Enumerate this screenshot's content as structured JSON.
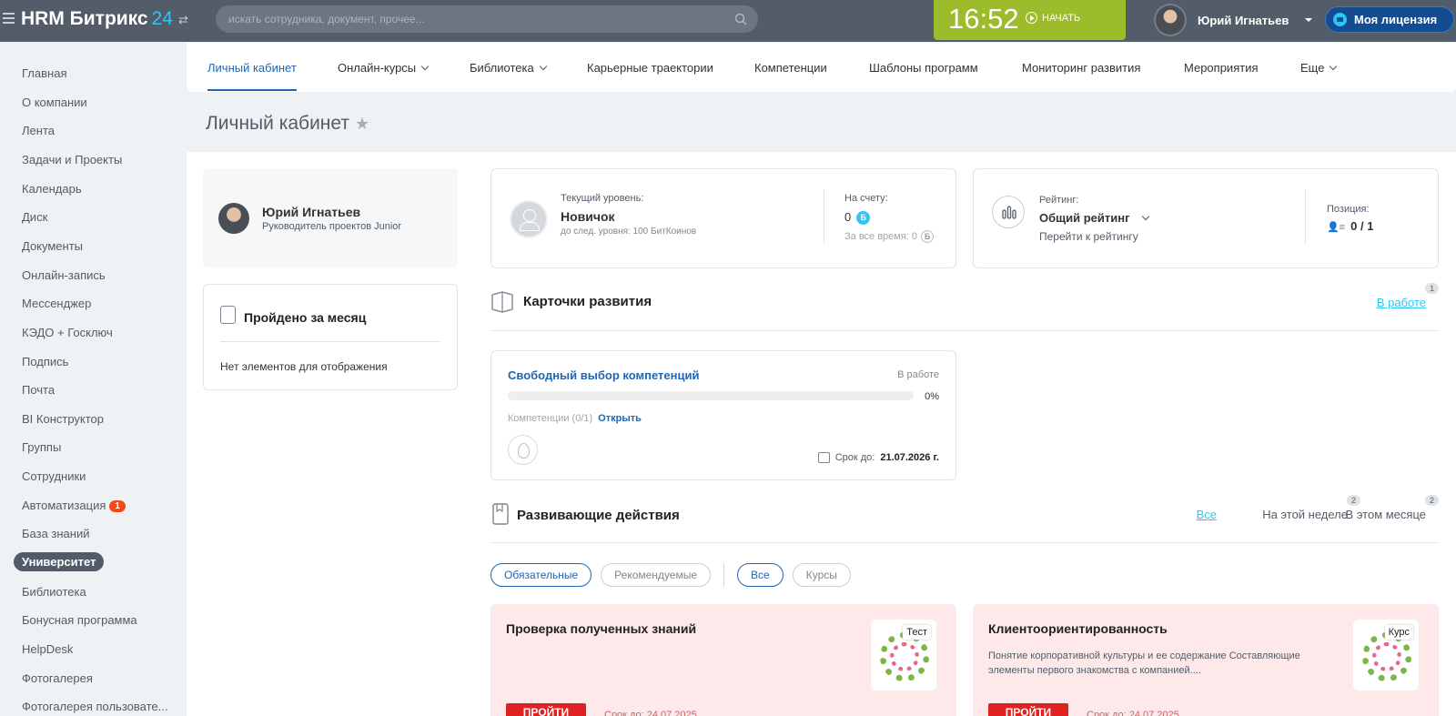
{
  "header": {
    "logo": "HRM Битрикс",
    "logo_num": "24",
    "search_placeholder": "искать сотрудника, документ, прочее...",
    "time": "16:52",
    "start_label": "НАЧАТЬ",
    "user_name": "Юрий Игнатьев",
    "license_label": "Моя лицензия"
  },
  "left_menu": [
    {
      "label": "Главная"
    },
    {
      "label": "О компании"
    },
    {
      "label": "Лента"
    },
    {
      "label": "Задачи и Проекты"
    },
    {
      "label": "Календарь"
    },
    {
      "label": "Диск"
    },
    {
      "label": "Документы"
    },
    {
      "label": "Онлайн-запись"
    },
    {
      "label": "Мессенджер"
    },
    {
      "label": "КЭДО + Госключ"
    },
    {
      "label": "Подпись"
    },
    {
      "label": "Почта"
    },
    {
      "label": "BI Конструктор"
    },
    {
      "label": "Группы"
    },
    {
      "label": "Сотрудники"
    },
    {
      "label": "Автоматизация",
      "badge": "1"
    },
    {
      "label": "База знаний"
    },
    {
      "label": "Университет",
      "active": true
    },
    {
      "label": "Библиотека"
    },
    {
      "label": "Бонусная программа"
    },
    {
      "label": "HelpDesk"
    },
    {
      "label": "Фотогалерея"
    },
    {
      "label": "Фотогалерея пользовате..."
    }
  ],
  "tabs": [
    {
      "label": "Личный кабинет",
      "active": true
    },
    {
      "label": "Онлайн-курсы",
      "dropdown": true
    },
    {
      "label": "Библиотека",
      "dropdown": true
    },
    {
      "label": "Карьерные траектории"
    },
    {
      "label": "Компетенции"
    },
    {
      "label": "Шаблоны программ"
    },
    {
      "label": "Мониторинг развития"
    },
    {
      "label": "Мероприятия"
    },
    {
      "label": "Еще",
      "dropdown": true
    }
  ],
  "page_title": "Личный кабинет",
  "profile": {
    "name": "Юрий Игнатьев",
    "position": "Руководитель проектов Junior"
  },
  "passed": {
    "title": "Пройдено за месяц",
    "empty": "Нет элементов для отображения"
  },
  "level": {
    "current_label": "Текущий уровень:",
    "current_value": "Новичок",
    "next_hint": "до след. уровня: 100 БитКоинов",
    "account_label": "На счету:",
    "account_value": "0",
    "coin_letter": "Б",
    "total_label": "За все время: 0"
  },
  "rating": {
    "label": "Рейтинг:",
    "selected": "Общий рейтинг",
    "link": "Перейти к рейтингу",
    "position_label": "Позиция:",
    "position_value": "0 / 1"
  },
  "dev_cards": {
    "title": "Карточки развития",
    "filter_link": "В работе",
    "filter_count": "1",
    "card": {
      "title": "Свободный выбор компетенций",
      "status": "В работе",
      "progress": 0,
      "progress_label": "0%",
      "competencies": "Компетенции (0/1)",
      "open": "Открыть",
      "due_label": "Срок до:",
      "due_date": "21.07.2026 г."
    }
  },
  "actions": {
    "title": "Развивающие действия",
    "period_tabs": [
      {
        "label": "Все",
        "active": true
      },
      {
        "label": "На этой неделе",
        "count": "2"
      },
      {
        "label": "В этом месяце",
        "count": "2"
      }
    ],
    "chips": [
      {
        "label": "Обязательные",
        "on": true
      },
      {
        "label": "Рекомендуемые"
      },
      {
        "label": "Все",
        "on": true
      },
      {
        "label": "Курсы"
      }
    ],
    "cards": [
      {
        "title": "Проверка полученных знаний",
        "desc": "",
        "tag": "Тест",
        "button": "ПРОЙТИ",
        "due": "Срок до: 24.07.2025"
      },
      {
        "title": "Клиентоориентированность",
        "desc": "Понятие корпоративной культуры и ее содержание Составляющие элементы первого знакомства с компанией....",
        "tag": "Курс",
        "button": "ПРОЙТИ",
        "due": "Срок до: 24.07.2025"
      }
    ]
  }
}
